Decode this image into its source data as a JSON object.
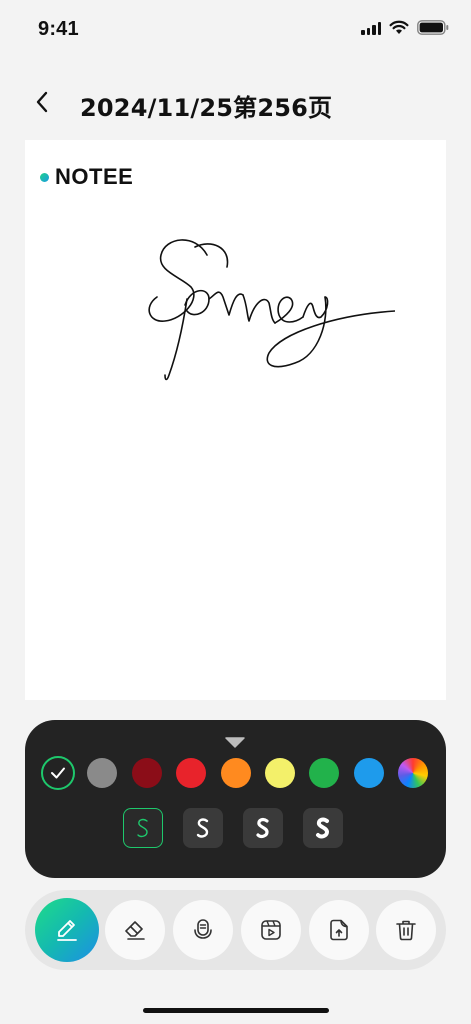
{
  "status_bar": {
    "time": "9:41",
    "signal_icon": "cellular-signal-icon",
    "wifi_icon": "wifi-icon",
    "battery_icon": "battery-icon"
  },
  "header": {
    "back_icon": "chevron-left-icon",
    "title": "2024/11/25第256页"
  },
  "canvas": {
    "brand_name": "NOTEE",
    "signature_text": "Sprney"
  },
  "palette": {
    "collapse_icon": "triangle-down-icon",
    "colors": [
      {
        "name": "selected-black",
        "hex": "#232323",
        "selected": true
      },
      {
        "name": "gray",
        "hex": "#8a8a8a"
      },
      {
        "name": "dark-red",
        "hex": "#8b0d18"
      },
      {
        "name": "red",
        "hex": "#e8232b"
      },
      {
        "name": "orange",
        "hex": "#ff8a1f"
      },
      {
        "name": "yellow",
        "hex": "#f3f06a"
      },
      {
        "name": "green",
        "hex": "#22b24b"
      },
      {
        "name": "blue",
        "hex": "#1e9bec"
      },
      {
        "name": "multicolor",
        "hex": "conic"
      }
    ],
    "stroke_widths": [
      {
        "label": "S",
        "selected": true
      },
      {
        "label": "S"
      },
      {
        "label": "S"
      },
      {
        "label": "S"
      }
    ],
    "accent": "#1ec86c"
  },
  "toolbar": {
    "tools": [
      {
        "name": "pen",
        "icon": "pen-icon",
        "active": true
      },
      {
        "name": "eraser",
        "icon": "eraser-icon"
      },
      {
        "name": "voice",
        "icon": "microphone-icon"
      },
      {
        "name": "video",
        "icon": "video-icon"
      },
      {
        "name": "upload",
        "icon": "upload-file-icon"
      },
      {
        "name": "delete",
        "icon": "trash-icon"
      }
    ]
  }
}
